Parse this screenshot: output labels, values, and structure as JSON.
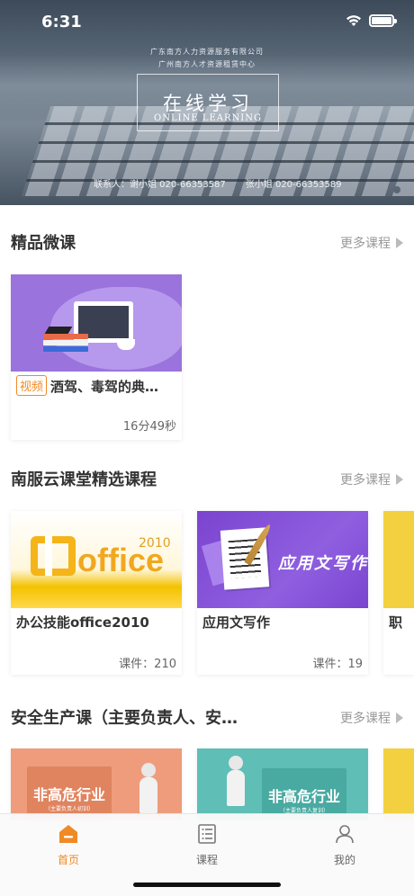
{
  "status_bar": {
    "time": "6:31"
  },
  "banner": {
    "company_line1": "广东南方人力资源服务有限公司",
    "company_line2": "广州南方人才资源租赁中心",
    "title": "在线学习",
    "subtitle": "ONLINE LEARNING",
    "contact_label": "联系人：谢小姐 020-66353587",
    "contact_label2": "张小姐 020-66353589"
  },
  "sections": [
    {
      "title": "精品微课",
      "more_label": "更多课程",
      "courses": [
        {
          "tag": "视频",
          "name": "酒驾、毒驾的典…",
          "meta": "16分49秒"
        }
      ]
    },
    {
      "title": "南服云课堂精选课程",
      "more_label": "更多课程",
      "courses": [
        {
          "name": "办公技能office2010",
          "meta": "课件：210",
          "thumb_text": "office",
          "thumb_year": "2010"
        },
        {
          "name": "应用文写作",
          "meta": "课件：19",
          "thumb_text": "应用文写作"
        },
        {
          "name": "职"
        }
      ]
    },
    {
      "title": "安全生产课（主要负责人、安…",
      "more_label": "更多课程",
      "courses": [
        {
          "thumb_text": "非高危行业",
          "thumb_sub": "（主要负责人初训）"
        },
        {
          "thumb_text": "非高危行业",
          "thumb_sub": "（主要负责人复训）"
        }
      ]
    }
  ],
  "tab_bar": {
    "items": [
      {
        "label": "首页",
        "icon": "home-icon",
        "active": true
      },
      {
        "label": "课程",
        "icon": "course-list-icon",
        "active": false
      },
      {
        "label": "我的",
        "icon": "profile-icon",
        "active": false
      }
    ]
  },
  "colors": {
    "accent": "#f08a24",
    "banner_bg": "#5f6e7d"
  }
}
